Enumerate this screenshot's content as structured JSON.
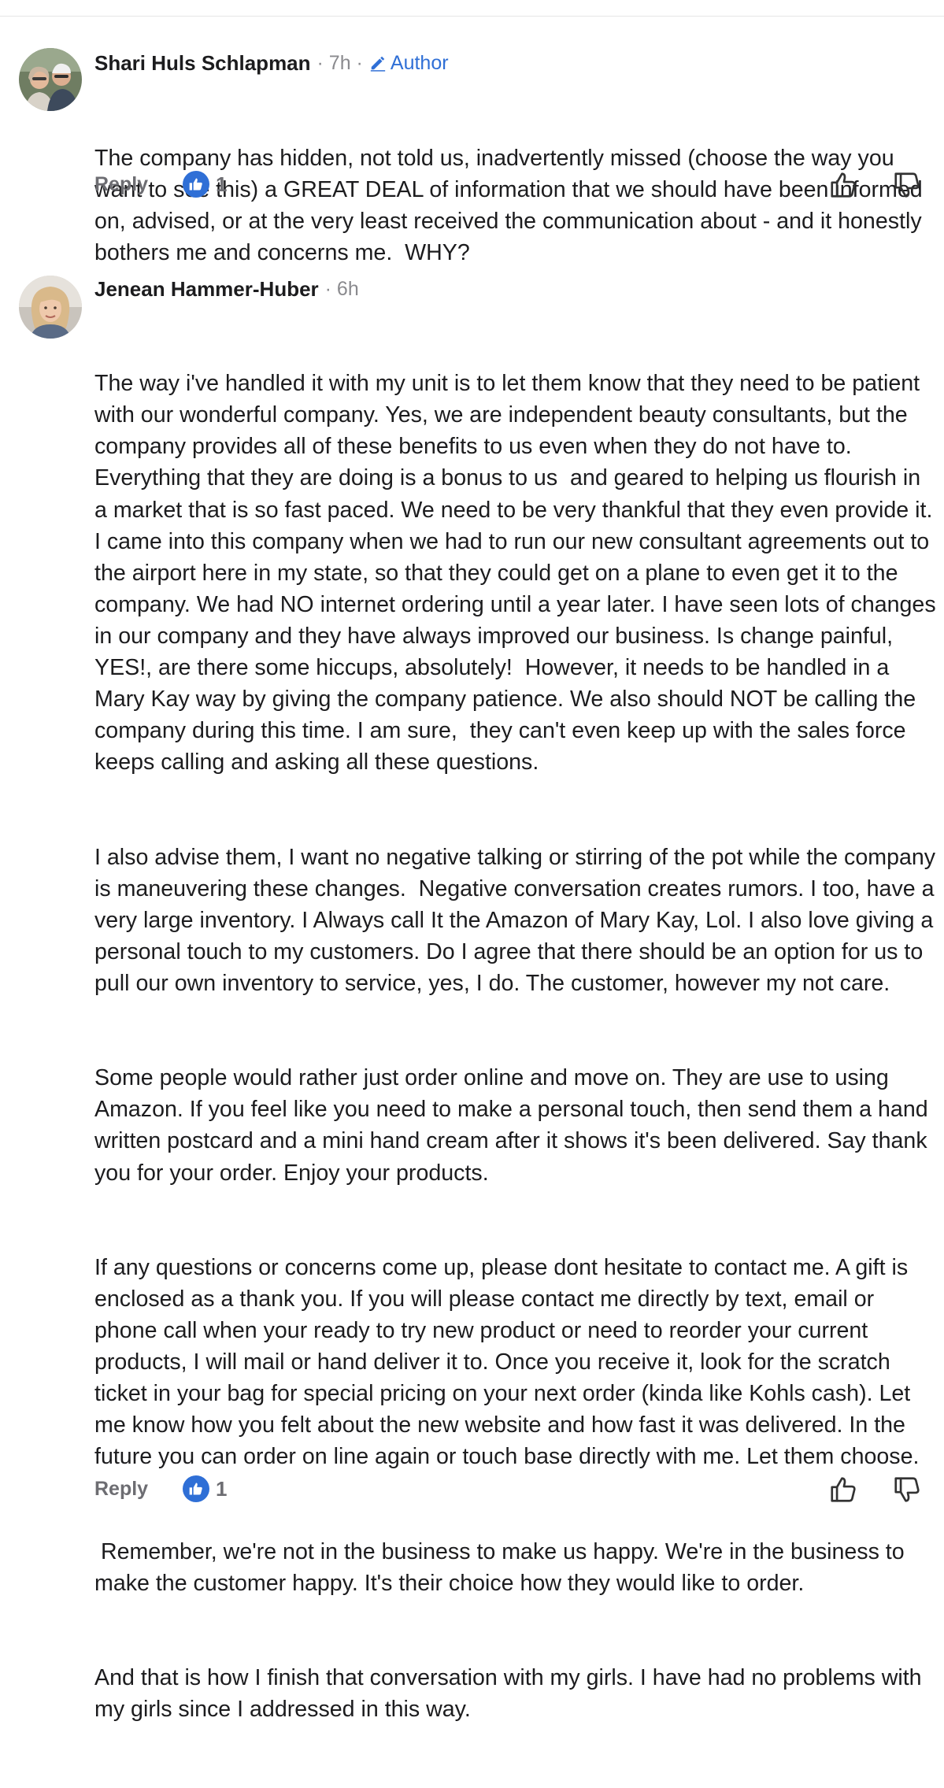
{
  "colors": {
    "accent": "#2f6fd6",
    "meta_gray": "#8a8a8e",
    "text": "#1c1c1e"
  },
  "comments": [
    {
      "author": "Shari Huls Schlapman",
      "time": "· 7h ·",
      "author_tag": "Author",
      "avatar_icon": "profile-photo-couple",
      "paragraphs": [
        "The company has hidden, not told us, inadvertently missed (choose the way you want to see this) a GREAT DEAL of information that we should have been informed on, advised, or at the very least received the communication about - and it honestly bothers me and concerns me.  WHY?"
      ],
      "reply_label": "Reply",
      "like_count": "1"
    },
    {
      "author": "Jenean Hammer-Huber",
      "time": "· 6h",
      "avatar_icon": "profile-photo-woman",
      "paragraphs": [
        "The way i've handled it with my unit is to let them know that they need to be patient with our wonderful company. Yes, we are independent beauty consultants, but the company provides all of these benefits to us even when they do not have to.  Everything that they are doing is a bonus to us  and geared to helping us flourish in a market that is so fast paced. We need to be very thankful that they even provide it. I came into this company when we had to run our new consultant agreements out to the airport here in my state, so that they could get on a plane to even get it to the company. We had NO internet ordering until a year later. I have seen lots of changes in our company and they have always improved our business. Is change painful, YES!, are there some hiccups, absolutely!  However, it needs to be handled in a Mary Kay way by giving the company patience. We also should NOT be calling the company during this time. I am sure,  they can't even keep up with the sales force keeps calling and asking all these questions.",
        "I also advise them, I want no negative talking or stirring of the pot while the company is maneuvering these changes.  Negative conversation creates rumors. I too, have a very large inventory. I Always call It the Amazon of Mary Kay, Lol. I also love giving a personal touch to my customers. Do I agree that there should be an option for us to pull our own inventory to service, yes, I do. The customer, however my not care.",
        "Some people would rather just order online and move on. They are use to using Amazon. If you feel like you need to make a personal touch, then send them a hand written postcard and a mini hand cream after it shows it's been delivered. Say thank you for your order. Enjoy your products.",
        "If any questions or concerns come up, please dont hesitate to contact me. A gift is enclosed as a thank you. If you will please contact me directly by text, email or phone call when your ready to try new product or need to reorder your current products, I will mail or hand deliver it to. Once you receive it, look for the scratch ticket in your bag for special pricing on your next order (kinda like Kohls cash). Let me know how you felt about the new website and how fast it was delivered. In the future you can order on line again or touch base directly with me. Let them choose.",
        " Remember, we're not in the business to make us happy. We're in the business to make the customer happy. It's their choice how they would like to order.",
        "And that is how I finish that conversation with my girls. I have had no problems with my girls since I addressed in this way."
      ],
      "reply_label": "Reply",
      "like_count": "1"
    }
  ]
}
